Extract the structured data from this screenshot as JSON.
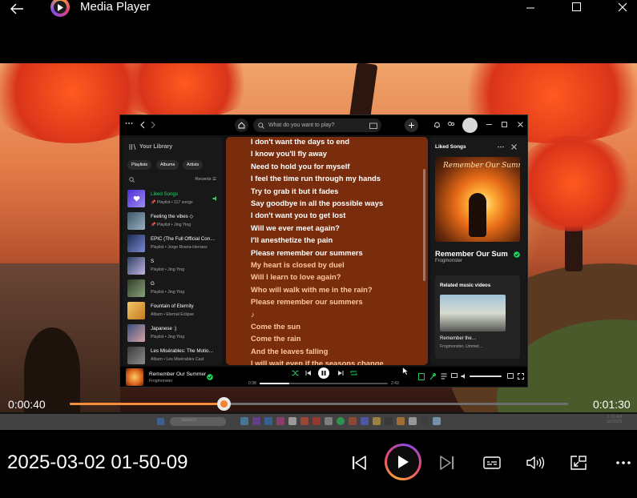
{
  "app": {
    "title": "Media Player",
    "accent": "#F58F3C"
  },
  "window_controls": [
    "minimize-icon",
    "maximize-icon",
    "close-icon"
  ],
  "spotify": {
    "search_placeholder": "What do you want to play?",
    "library": {
      "title": "Your Library",
      "filters": [
        "Playlists",
        "Albums",
        "Artists"
      ],
      "sort_label": "Recents",
      "items": [
        {
          "title": "Liked Songs",
          "subtitle": "Playlist • 117 songs",
          "active": true
        },
        {
          "title": "Feeling the vibes ◇",
          "subtitle": "Playlist • Jing Ying"
        },
        {
          "title": "EPIC (The Full Official Con…",
          "subtitle": "Playlist • Jorge Rivera-Herrans"
        },
        {
          "title": "S",
          "subtitle": "Playlist • Jing Ying"
        },
        {
          "title": "G",
          "subtitle": "Playlist • Jing Ying"
        },
        {
          "title": "Fountain of Eternity",
          "subtitle": "Album • Eternal Eclipse"
        },
        {
          "title": "Japanese :)",
          "subtitle": "Playlist • Jing Ying"
        },
        {
          "title": "Les Misérables: The Motio…",
          "subtitle": "Album • Les Misérables Cast"
        }
      ]
    },
    "lyrics": {
      "lines": [
        {
          "text": "I don't want the days to end",
          "state": "past"
        },
        {
          "text": "I know you'll fly away",
          "state": "past"
        },
        {
          "text": "Need to hold you for myself",
          "state": "past"
        },
        {
          "text": "I feel the time run through my hands",
          "state": "past"
        },
        {
          "text": "Try to grab it but it fades",
          "state": "past"
        },
        {
          "text": "Say goodbye in all the possible ways",
          "state": "past"
        },
        {
          "text": "I don't want you to get lost",
          "state": "past"
        },
        {
          "text": "Will we ever meet again?",
          "state": "past"
        },
        {
          "text": "I'll anesthetize the pain",
          "state": "past"
        },
        {
          "text": "Please remember our summers",
          "state": "current"
        },
        {
          "text": "My heart is closed by duel",
          "state": "future"
        },
        {
          "text": "Will I learn to love again?",
          "state": "future"
        },
        {
          "text": "Who will walk with me in the rain?",
          "state": "future"
        },
        {
          "text": "Please remember our summers",
          "state": "future"
        },
        {
          "text": "♪",
          "state": "future"
        },
        {
          "text": "Come the sun",
          "state": "future"
        },
        {
          "text": "Come the rain",
          "state": "future"
        },
        {
          "text": "And the leaves falling",
          "state": "future"
        },
        {
          "text": "I will wait even if the seasons change",
          "state": "future"
        }
      ]
    },
    "now_playing_panel": {
      "header": "Liked Songs",
      "cover_text": "Remember Our Summer",
      "track_title": "Remember Our Sum",
      "artist": "Frogmonster",
      "related_header": "Related music videos",
      "related_title": "Remember the…",
      "related_subtitle": "Frogmonster, Ummet…"
    },
    "player": {
      "track": "Remember Our Summer",
      "artist": "Frogmonster",
      "elapsed": "0:38",
      "duration": "2:43",
      "progress": 0.23
    }
  },
  "taskbar": {
    "search_label": "Search",
    "clock_time": "1:50 AM",
    "clock_date": "3/2/2025"
  },
  "playback": {
    "elapsed": "0:00:40",
    "remaining": "0:01:30",
    "progress": 0.31,
    "file_title": "2025-03-02 01-50-09"
  },
  "controls": [
    "previous-icon",
    "play-icon",
    "next-icon",
    "subtitles-icon",
    "volume-icon",
    "mini-player-icon",
    "more-icon"
  ]
}
